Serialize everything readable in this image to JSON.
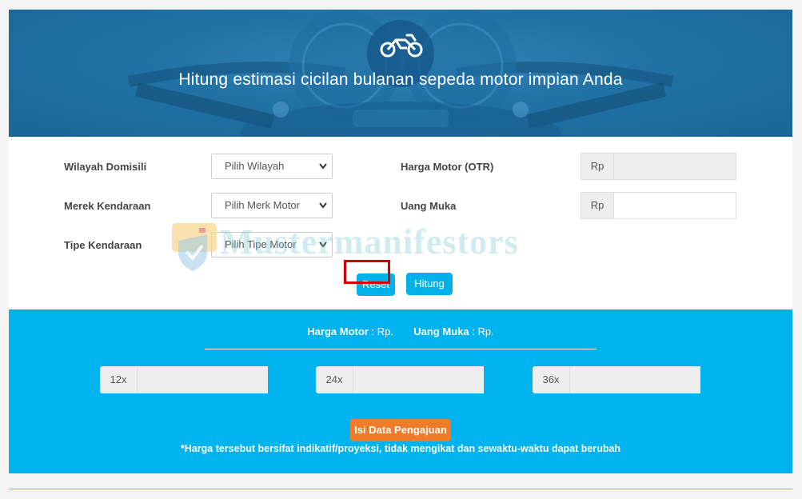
{
  "banner": {
    "title": "Hitung estimasi cicilan bulanan sepeda motor impian Anda",
    "icon": "motorcycle-icon"
  },
  "form": {
    "region_label": "Wilayah Domisili",
    "region_selected": "Pilih Wilayah",
    "brand_label": "Merek Kendaraan",
    "brand_selected": "Pilih Merk Motor",
    "type_label": "Tipe Kendaraan",
    "type_selected": "Pilih Tipe Motor",
    "price_label": "Harga Motor (OTR)",
    "price_prefix": "Rp",
    "price_value": "",
    "dp_label": "Uang Muka",
    "dp_prefix": "Rp",
    "dp_value": "",
    "reset_label": "Reset",
    "calculate_label": "Hitung"
  },
  "watermark": {
    "text": "Mustermanifestors"
  },
  "result": {
    "price_label": "Harga Motor",
    "price_value": ": Rp.",
    "dp_label": "Uang Muka",
    "dp_value": ": Rp.",
    "tenors": [
      {
        "label": "12x",
        "value": ""
      },
      {
        "label": "24x",
        "value": ""
      },
      {
        "label": "36x",
        "value": ""
      }
    ],
    "apply_label": "Isi Data Pengajuan",
    "disclaimer": "*Harga tersebut bersifat indikatif/proyeksi, tidak mengikat dan sewaktu-waktu dapat berubah"
  },
  "colors": {
    "banner": "#2273a6",
    "accent": "#00b2ee",
    "apply": "#f07c2a",
    "highlight": "#d40000"
  }
}
